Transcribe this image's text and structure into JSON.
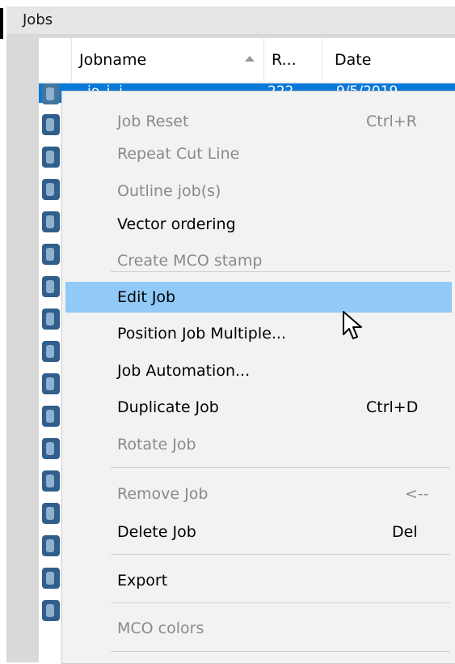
{
  "panel": {
    "title": "Jobs"
  },
  "columns": {
    "name": "Jobname",
    "r": "R...",
    "date": "Date"
  },
  "selected_row": {
    "name": "jo_i..i",
    "r": "222",
    "date": "9/5/2019"
  },
  "menu": {
    "items": [
      {
        "label": "Job Reset",
        "shortcut": "Ctrl+R",
        "enabled": false
      },
      {
        "label": "Repeat Cut Line",
        "shortcut": "",
        "enabled": false
      },
      {
        "label": "Outline job(s)",
        "shortcut": "",
        "enabled": false
      },
      {
        "label": "Vector ordering",
        "shortcut": "",
        "enabled": true
      },
      {
        "label": "Create MCO stamp",
        "shortcut": "",
        "enabled": false
      },
      {
        "label": "Edit Job",
        "shortcut": "",
        "enabled": true,
        "hover": true
      },
      {
        "label": "Position Job Multiple...",
        "shortcut": "",
        "enabled": true
      },
      {
        "label": "Job Automation...",
        "shortcut": "",
        "enabled": true
      },
      {
        "label": "Duplicate Job",
        "shortcut": "Ctrl+D",
        "enabled": true
      },
      {
        "label": "Rotate Job",
        "shortcut": "",
        "enabled": false
      },
      {
        "label": "Remove Job",
        "shortcut": "<--",
        "enabled": false
      },
      {
        "label": "Delete Job",
        "shortcut": "Del",
        "enabled": true
      },
      {
        "label": "Export",
        "shortcut": "",
        "enabled": true
      },
      {
        "label": "MCO colors",
        "shortcut": "",
        "enabled": false
      }
    ]
  },
  "colors": {
    "selection": "#0a78d7",
    "menu_hover": "#91c9f7",
    "menu_bg": "#f2f2f2",
    "disabled_text": "#8a8a8a"
  },
  "icons": {
    "job_row": "job-file-icon",
    "cursor": "mouse-pointer-icon",
    "sort": "sort-ascending-icon"
  }
}
